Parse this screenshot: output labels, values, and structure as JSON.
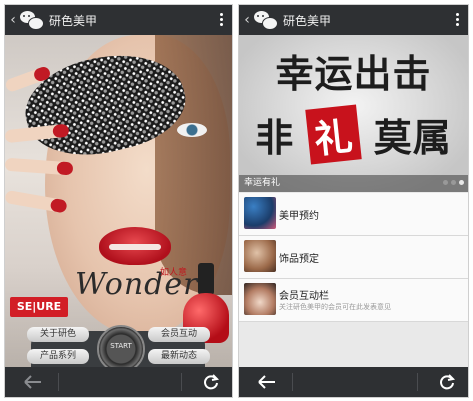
{
  "left_screen": {
    "header": {
      "title": "研色美甲"
    },
    "poster": {
      "wonder_text": "Wonder",
      "wonder_sub": "如人意",
      "brand_badge": "SE|URE",
      "nav": {
        "about": "关于研色",
        "member": "会员互动",
        "products": "产品系列",
        "news": "最新动态",
        "start": "START"
      }
    }
  },
  "right_screen": {
    "header": {
      "title": "研色美甲"
    },
    "banner": {
      "line1": "幸运出击",
      "line2_left": "非",
      "line2_red": "礼",
      "line2_right": "莫属",
      "caption": "幸运有礼"
    },
    "menu": [
      {
        "label": "美甲预约",
        "sub": ""
      },
      {
        "label": "饰品预定",
        "sub": ""
      },
      {
        "label": "会员互动栏",
        "sub": "关注研色美甲的会员可在此发表意见"
      }
    ]
  },
  "colors": {
    "bar": "#2e3033",
    "accent_red": "#c8121c"
  },
  "icons": [
    "chevron-left-icon",
    "wechat-icon",
    "more-icon",
    "back-arrow-icon",
    "refresh-icon"
  ]
}
